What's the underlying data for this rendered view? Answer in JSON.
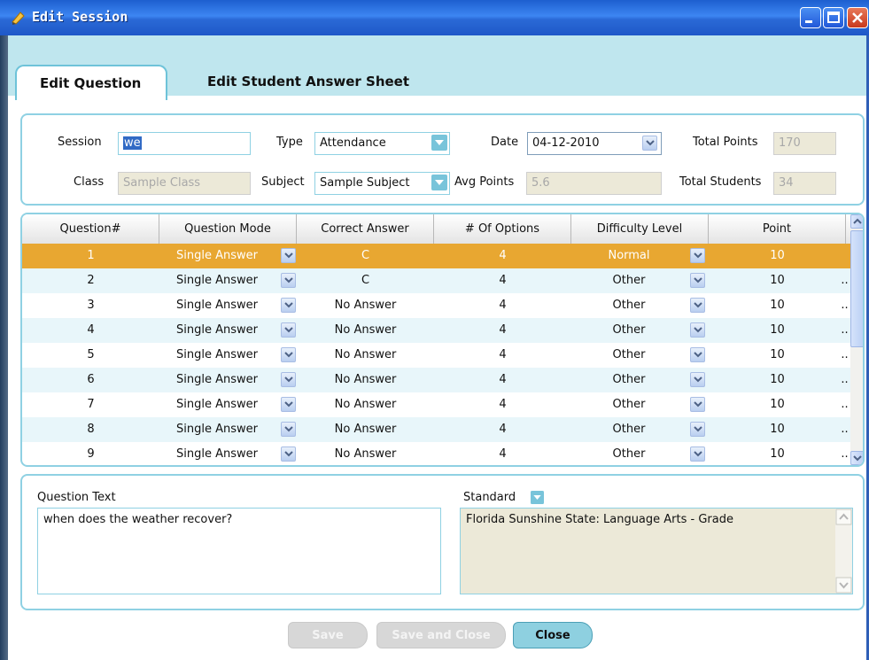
{
  "window": {
    "title": "Edit Session"
  },
  "tabs": [
    {
      "label": "Edit Question",
      "active": true
    },
    {
      "label": "Edit Student Answer Sheet",
      "active": false
    }
  ],
  "form": {
    "session_label": "Session",
    "session_value": "we",
    "type_label": "Type",
    "type_value": "Attendance",
    "date_label": "Date",
    "date_value": "04-12-2010",
    "total_points_label": "Total Points",
    "total_points_value": "170",
    "class_label": "Class",
    "class_value": "Sample Class",
    "subject_label": "Subject",
    "subject_value": "Sample Subject",
    "avg_points_label": "Avg Points",
    "avg_points_value": "5.6",
    "total_students_label": "Total Students",
    "total_students_value": "34"
  },
  "grid": {
    "columns": [
      "Question#",
      "Question Mode",
      "Correct Answer",
      "# Of Options",
      "Difficulty Level",
      "Point"
    ],
    "rows": [
      {
        "num": "1",
        "mode": "Single Answer",
        "answer": "C",
        "options": "4",
        "difficulty": "Normal",
        "point": "10",
        "extra": ""
      },
      {
        "num": "2",
        "mode": "Single Answer",
        "answer": "C",
        "options": "4",
        "difficulty": "Other",
        "point": "10",
        "extra": ".."
      },
      {
        "num": "3",
        "mode": "Single Answer",
        "answer": "No Answer",
        "options": "4",
        "difficulty": "Other",
        "point": "10",
        "extra": ".."
      },
      {
        "num": "4",
        "mode": "Single Answer",
        "answer": "No Answer",
        "options": "4",
        "difficulty": "Other",
        "point": "10",
        "extra": ".."
      },
      {
        "num": "5",
        "mode": "Single Answer",
        "answer": "No Answer",
        "options": "4",
        "difficulty": "Other",
        "point": "10",
        "extra": ".."
      },
      {
        "num": "6",
        "mode": "Single Answer",
        "answer": "No Answer",
        "options": "4",
        "difficulty": "Other",
        "point": "10",
        "extra": ".."
      },
      {
        "num": "7",
        "mode": "Single Answer",
        "answer": "No Answer",
        "options": "4",
        "difficulty": "Other",
        "point": "10",
        "extra": ".."
      },
      {
        "num": "8",
        "mode": "Single Answer",
        "answer": "No Answer",
        "options": "4",
        "difficulty": "Other",
        "point": "10",
        "extra": ".."
      },
      {
        "num": "9",
        "mode": "Single Answer",
        "answer": "No Answer",
        "options": "4",
        "difficulty": "Other",
        "point": "10",
        "extra": ".."
      }
    ]
  },
  "question": {
    "label": "Question Text",
    "text": "when does the weather recover?"
  },
  "standard": {
    "label": "Standard",
    "text": "Florida Sunshine State: Language Arts - Grade"
  },
  "buttons": {
    "save": "Save",
    "save_close": "Save and Close",
    "close": "Close"
  },
  "colors": {
    "accent": "#8fd1e3",
    "selected_row": "#e8a731",
    "titlebar": "#2a69d6"
  }
}
